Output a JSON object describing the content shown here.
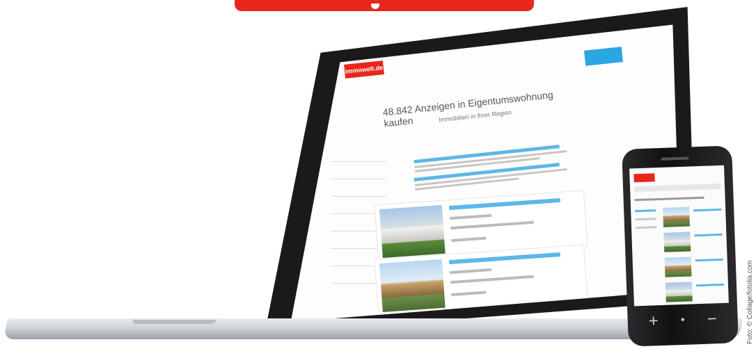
{
  "banner": {
    "color": "#e8261c"
  },
  "laptop": {
    "site_logo": "immowelt.de",
    "headline": "48.842 Anzeigen in Eigentumswohnung kaufen",
    "subheadline": "Immobilien in Ihrer Region",
    "accent": "#2aa6e0"
  },
  "phone": {
    "logo_color": "#e8261c",
    "buttons": [
      "+",
      "•",
      "−"
    ]
  },
  "credit": "Foto: © Collage/fotolia.com"
}
